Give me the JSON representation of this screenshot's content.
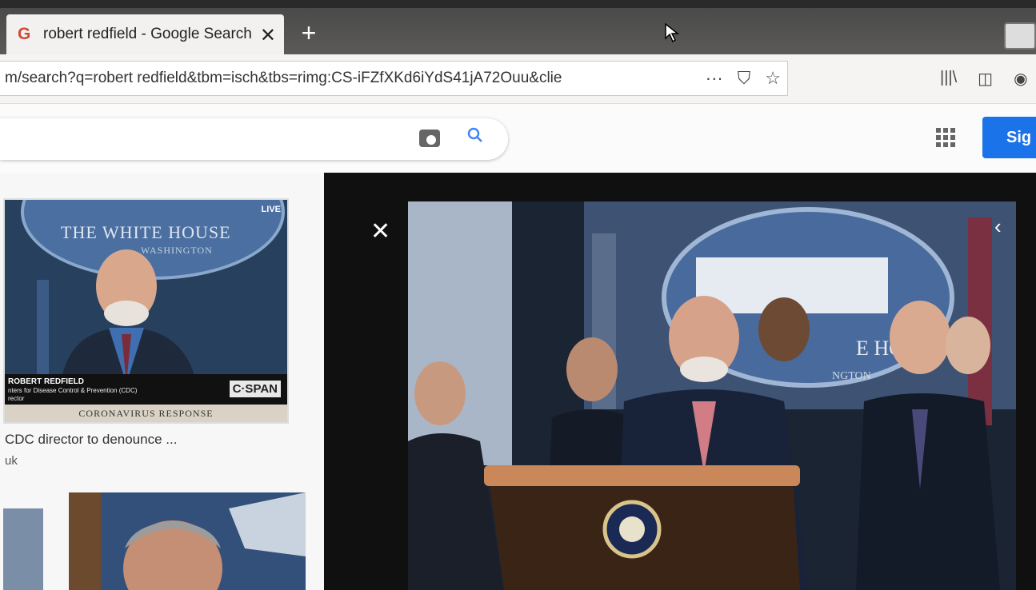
{
  "browser": {
    "tab": {
      "title": "robert redfield - Google Search",
      "icon": "google-g-icon",
      "close": "✕"
    },
    "new_tab": "+",
    "url": "m/search?q=robert redfield&tbm=isch&tbs=rimg:CS-iFZfXKd6iYdS41jA72Ouu&clie",
    "url_actions": {
      "more": "···",
      "pocket": "⛉",
      "bookmark": "☆"
    },
    "toolbar": {
      "library": "|||\\",
      "sidebar": "◫",
      "account": "◉"
    }
  },
  "google": {
    "apps_icon": "apps-grid-icon",
    "sign_in": "Sig"
  },
  "results": {
    "thumb1": {
      "seal_text": "THE WHITE HOUSE",
      "seal_sub": "WASHINGTON",
      "live": "LIVE",
      "lower_third_name": "ROBERT REDFIELD",
      "lower_third_org": "nters for Disease Control & Prevention (CDC)",
      "lower_third_role": "rector",
      "network": "C·SPAN",
      "banner": "CORONAVIRUS RESPONSE"
    },
    "title": "CDC director to denounce ...",
    "source": "uk"
  },
  "viewer": {
    "close": "✕",
    "prev": "‹",
    "photo_seal_text": "E HOU",
    "photo_seal_sub": "NGTON"
  },
  "colors": {
    "google_blue": "#1a73e8",
    "viewer_bg": "#101010"
  }
}
